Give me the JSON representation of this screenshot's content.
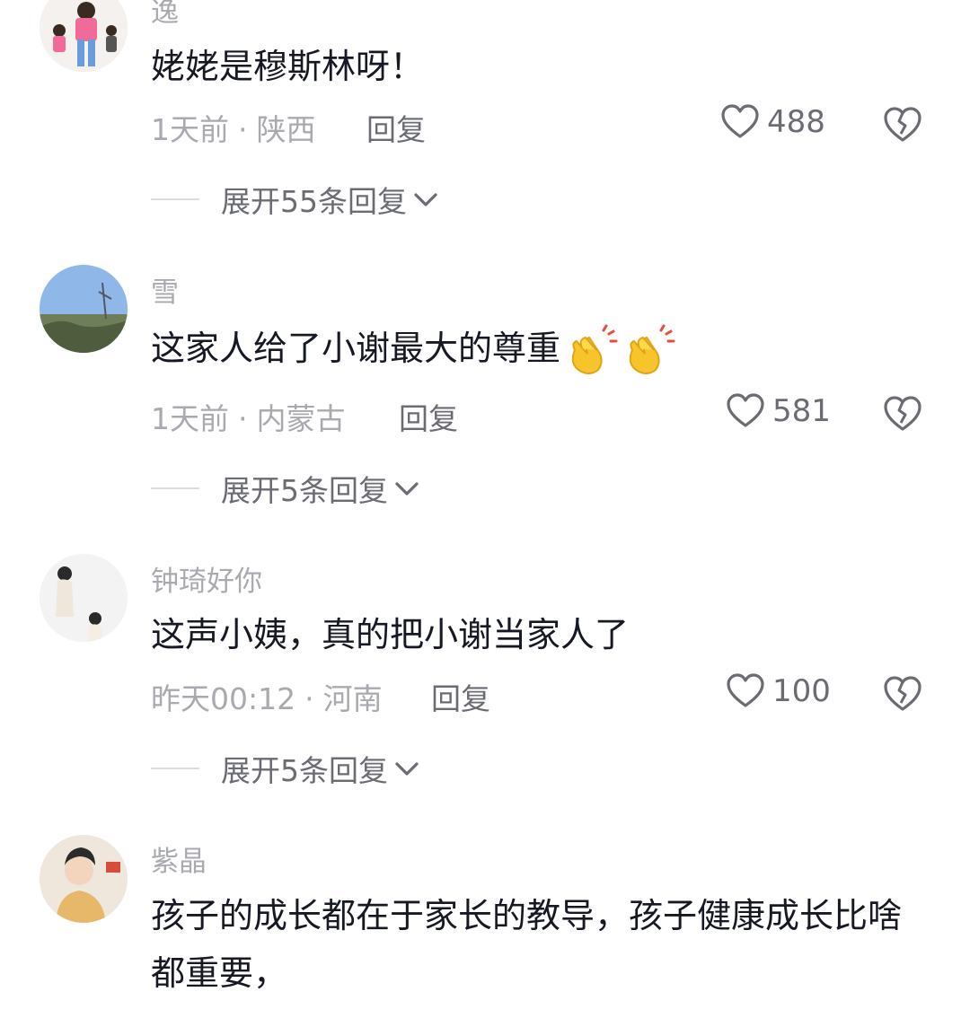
{
  "comments": [
    {
      "username": "逸",
      "content": "姥姥是穆斯林呀！",
      "time": "1天前",
      "location": "陕西",
      "reply_label": "回复",
      "likes": "488",
      "expand_label": "展开55条回复"
    },
    {
      "username": "雪",
      "content": "这家人给了小谢最大的尊重",
      "time": "1天前",
      "location": "内蒙古",
      "reply_label": "回复",
      "likes": "581",
      "expand_label": "展开5条回复"
    },
    {
      "username": "钟琦好你",
      "content": "这声小姨，真的把小谢当家人了",
      "time": "昨天00:12",
      "location": "河南",
      "reply_label": "回复",
      "likes": "100",
      "expand_label": "展开5条回复"
    },
    {
      "username": "紫晶",
      "content": "孩子的成长都在于家长的教导，孩子健康成长比啥都重要，"
    }
  ],
  "icons": {
    "like": "heart-outline-icon",
    "dislike": "broken-heart-icon",
    "expand": "chevron-down-icon",
    "emoji": "clapping-hands-emoji"
  },
  "colors": {
    "text": "#161823",
    "muted": "#a9aab0",
    "secondary": "#6b6c73"
  }
}
